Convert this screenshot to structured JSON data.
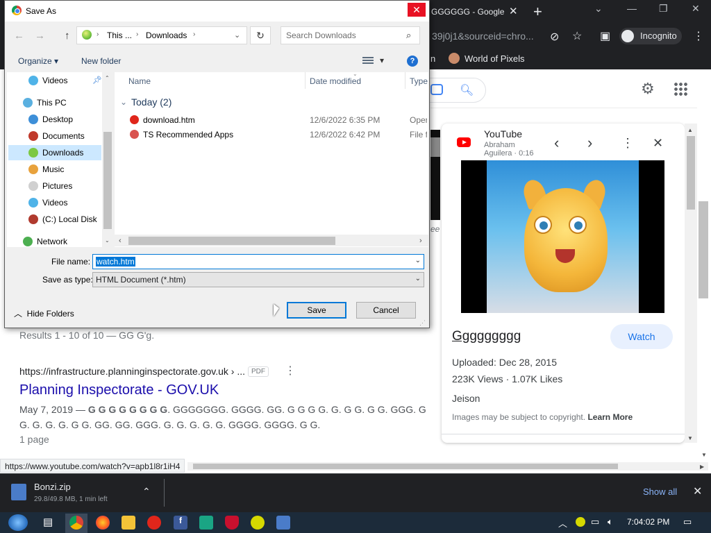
{
  "browser": {
    "tab_title": "GGGGGG - Google",
    "address_fragment": "39j0j1&sourceid=chro...",
    "incognito_label": "Incognito",
    "bookmark_fragment": "n",
    "bookmark_label": "World of Pixels"
  },
  "results": {
    "count_text": "Results 1 - 10 of 10 — GG G'g.",
    "url": "https://infrastructure.planninginspectorate.gov.uk › ...",
    "pdf_badge": "PDF",
    "title": "Planning Inspectorate - GOV.UK",
    "snippet_date": "May 7, 2019 — ",
    "snippet_bold": "G G G G G G G G",
    "snippet_rest": ". GGGGGGG. GGGG. GG. G G G G. G. G G. G G. GGG. G",
    "snippet_line2": "G. G. G. G. G G. GG. GG. GGG. G. G. G. G. G. GGGG. GGGG. G G.",
    "meta": "1 page",
    "partial_text": "ee"
  },
  "knowledge_panel": {
    "source": "YouTube",
    "author": "Abraham Aguilera",
    "duration": "0:16",
    "title": "Ggggggggg",
    "watch_label": "Watch",
    "uploaded": "Uploaded: Dec 28, 2015",
    "views": "223K Views",
    "likes": "1.07K Likes",
    "channel": "Jeison",
    "copyright": "Images may be subject to copyright.",
    "learn_more": "Learn More"
  },
  "status_url": "https://www.youtube.com/watch?v=apb1l8r1iH4",
  "downloads": {
    "file_name": "Bonzi.zip",
    "progress_text": "29.8/49.8 MB, 1 min left",
    "show_all": "Show all"
  },
  "taskbar": {
    "time": "7:04:02 PM"
  },
  "dialog": {
    "title": "Save As",
    "breadcrumb": [
      "This ...",
      "Downloads"
    ],
    "search_placeholder": "Search Downloads",
    "organize_label": "Organize",
    "new_folder_label": "New folder",
    "help_label": "?",
    "nav_items": [
      {
        "label": "Videos",
        "color": "#4fb3e8"
      },
      {
        "label": "This PC",
        "color": "#5ab0e0"
      },
      {
        "label": "Desktop",
        "color": "#3d8fd8"
      },
      {
        "label": "Documents",
        "color": "#c0392b"
      },
      {
        "label": "Downloads",
        "color": "#7cc843"
      },
      {
        "label": "Music",
        "color": "#e8a23d"
      },
      {
        "label": "Pictures",
        "color": "#d0d0d0"
      },
      {
        "label": "Videos",
        "color": "#4fb3e8"
      },
      {
        "label": "(C:) Local Disk",
        "color": "#b03a2e"
      },
      {
        "label": "Network",
        "color": "#4caf50"
      }
    ],
    "columns": {
      "name": "Name",
      "date": "Date modified",
      "type": "Type"
    },
    "group_label": "Today (2)",
    "files": [
      {
        "name": "download.htm",
        "date": "12/6/2022 6:35 PM",
        "type": "Oper",
        "color": "#e0261b"
      },
      {
        "name": "TS Recommended Apps",
        "date": "12/6/2022 6:42 PM",
        "type": "File fo",
        "color": "#d9534f"
      }
    ],
    "file_name_label": "File name:",
    "file_name_value": "watch.htm",
    "save_type_label": "Save as type:",
    "save_type_value": "HTML Document (*.htm)",
    "hide_folders_label": "Hide Folders",
    "save_label": "Save",
    "cancel_label": "Cancel"
  }
}
